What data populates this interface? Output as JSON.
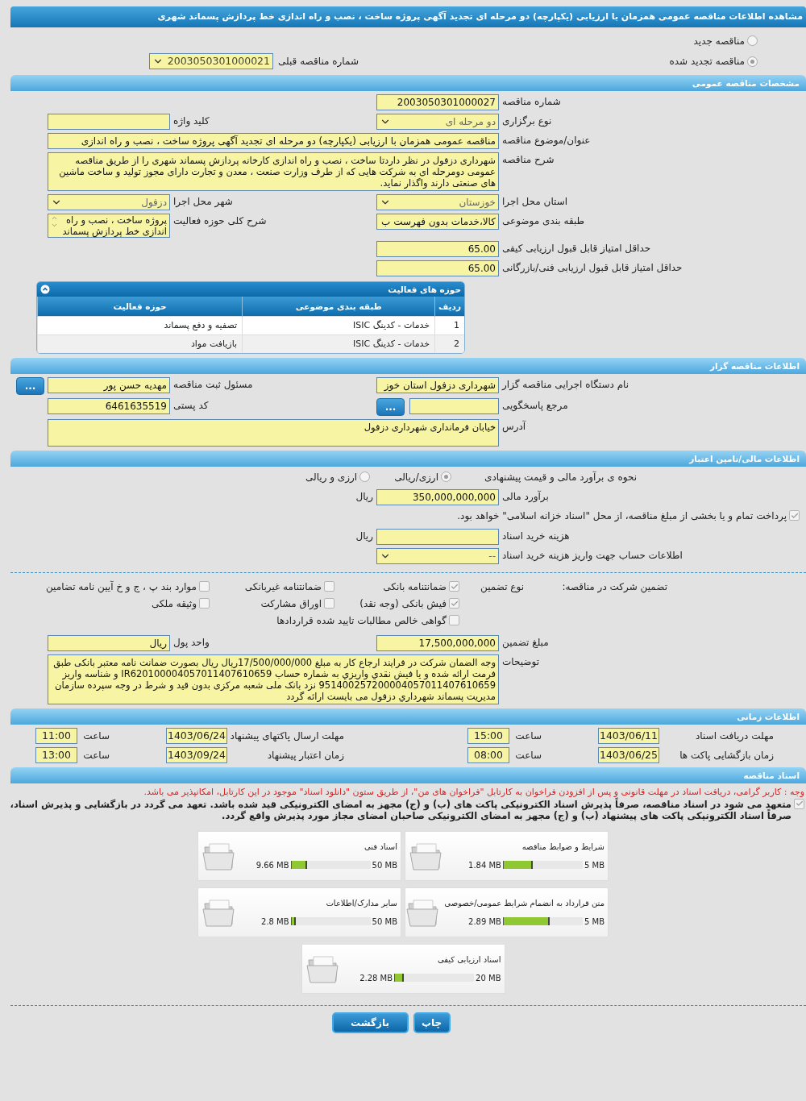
{
  "title": "مشاهده اطلاعات مناقصه عمومی همزمان با ارزیابی (یکپارچه) دو مرحله ای تجدید آگهی پروژه ساخت ، نصب و راه اندازی خط پردازش پسماند شهری",
  "tender_status": [
    {
      "label": "مناقصه جدید",
      "selected": false
    },
    {
      "label": "مناقصه تجدید شده",
      "selected": true
    }
  ],
  "previous_tender": {
    "label": "شماره مناقصه قبلی",
    "value": "2003050301000021"
  },
  "general": {
    "heading": "مشخصات مناقصه عمومی",
    "rows": [
      [
        {
          "label": "شماره مناقصه",
          "value": "2003050301000027",
          "kind": "text"
        }
      ],
      [
        {
          "label": "نوع برگزاری",
          "value": "دو مرحله ای",
          "kind": "select"
        },
        {
          "label": "کلید واژه",
          "kind": "text"
        }
      ],
      [
        {
          "label": "عنوان/موضوع مناقصه",
          "value": "مناقصه عمومی همزمان با ارزیابی (یکپارچه) دو مرحله ای تجدید آگهی پروژه ساخت ، نصب و راه اندازی",
          "kind": "wide"
        }
      ],
      [
        {
          "label": "شرح مناقصه",
          "value": "شهرداری دزفول در نظر داردتا ساخت ، نصب و راه اندازی کارخانه پردازش پسماند شهری را از طریق مناقصه عمومی دومرحله ای به شرکت هایی که از طرف وزارت صنعت ، معدن و تجارت دارای مجوز تولید و ساخت ماشین های صنعتی دارند واگذار نماید.",
          "kind": "textarea"
        }
      ],
      [
        {
          "label": "استان محل اجرا",
          "value": "خوزستان",
          "kind": "select"
        },
        {
          "label": "شهر محل اجرا",
          "value": "دزفول",
          "kind": "select"
        }
      ],
      [
        {
          "label": "طبقه بندی موضوعی",
          "value": "کالا،خدمات بدون فهرست ب",
          "kind": "text"
        },
        {
          "label": "شرح کلی حوزه فعالیت",
          "value": "پروژه ساخت ، نصب و راه اندازی خط پردازش پسماند",
          "kind": "scroll"
        }
      ],
      [
        {
          "label": "حداقل امتیاز قابل قبول ارزیابی کیفی",
          "value": "65.00",
          "kind": "text"
        }
      ],
      [
        {
          "label": "حداقل امتیاز قابل قبول ارزیابی فنی/بازرگانی",
          "value": "65.00",
          "kind": "text"
        }
      ]
    ]
  },
  "activity": {
    "title": "حوزه های فعالیت",
    "columns": [
      "ردیف",
      "طبقه بندی موضوعی",
      "حوزه فعالیت"
    ],
    "rows": [
      [
        "1",
        "خدمات - کدینگ ISIC",
        "تصفیه و دفع پسماند"
      ],
      [
        "2",
        "خدمات - کدینگ ISIC",
        "بازیافت مواد"
      ]
    ]
  },
  "organizer": {
    "heading": "اطلاعات مناقصه گزار",
    "rows": [
      [
        {
          "label": "نام دستگاه اجرایی مناقصه گزار",
          "value": "شهرداری دزفول استان خوز",
          "kind": "text"
        },
        {
          "label": "مسئول ثبت مناقصه",
          "value": "مهدیه حسن پور",
          "kind": "text",
          "button": "..."
        }
      ],
      [
        {
          "label": "مرجع پاسخگویی",
          "kind": "text",
          "button": "..."
        },
        {
          "label": "کد پستی",
          "value": "6461635519",
          "kind": "text"
        }
      ],
      [
        {
          "label": "آدرس",
          "value": "خیابان فرمانداری شهرداری دزفول",
          "kind": "textarea"
        }
      ]
    ]
  },
  "finance": {
    "heading": "اطلاعات مالی/تامین اعتبار",
    "method": {
      "label": "نحوه ی برآورد مالی و قیمت پیشنهادی",
      "options": [
        {
          "label": "ارزی/ریالی",
          "selected": true
        },
        {
          "label": "ارزی و ریالی",
          "selected": false
        }
      ]
    },
    "rows": [
      [
        {
          "label": "برآورد مالی",
          "value": "350,000,000,000",
          "kind": "text",
          "unit": "ریال"
        }
      ]
    ],
    "treasury": {
      "label": "پرداخت تمام و یا بخشی از مبلغ مناقصه، از محل \"اسناد خزانه اسلامی\" خواهد بود.",
      "checked": true
    },
    "rows_after": [
      [
        {
          "label": "هزینه خرید اسناد",
          "kind": "text",
          "unit": "ریال"
        }
      ],
      [
        {
          "label": "اطلاعات حساب جهت واریز هزینه خرید اسناد",
          "value": "--",
          "kind": "select"
        }
      ]
    ]
  },
  "guarantee": {
    "title": "تضمین شرکت در مناقصه:",
    "type_label": "نوع تضمین",
    "options": [
      {
        "label": "ضمانتنامه بانکی",
        "checked": true
      },
      {
        "label": "ضمانتنامه غیربانکی",
        "checked": false
      },
      {
        "label": "موارد بند پ ، ج و خ آیین نامه تضامین",
        "checked": false
      },
      {
        "label": "فیش بانکی (وجه نقد)",
        "checked": true
      },
      {
        "label": "اوراق مشارکت",
        "checked": false
      },
      {
        "label": "وثیقه ملکی",
        "checked": false
      },
      {
        "label": "گواهی خالص مطالبات تایید شده قراردادها",
        "checked": false
      }
    ],
    "rows": [
      [
        {
          "label": "مبلغ تضمین",
          "value": "17,500,000,000",
          "kind": "text"
        },
        {
          "label": "واحد پول",
          "value": "ریال",
          "kind": "text"
        }
      ],
      [
        {
          "label": "توضیحات",
          "value": "وجه الضمان شرکت در فرایند ارجاع کار به  مبلغ  17/500/000/000ریال ریال بصورت ضمانت نامه معتبر بانکی طبق فرمت ارائه شده و یا  فیش نقدي واريزي  به شماره حساب  IR620100004057011407610659 و شناسه واریز 951400257200004057011407610659 نزد بانک ملی شعبه مرکزی  بدون قید و شرط در وجه سپرده سازمان مدیریت پسماند شهرداري دزفول می بایست ارائه گردد",
          "kind": "textarea"
        }
      ]
    ]
  },
  "timing": {
    "heading": "اطلاعات زمانی",
    "items": [
      {
        "label": "مهلت دریافت اسناد",
        "date": "1403/06/11",
        "time_label": "ساعت",
        "time": "15:00"
      },
      {
        "label": "مهلت ارسال پاکتهای پیشنهاد",
        "date": "1403/06/24",
        "time_label": "ساعت",
        "time": "11:00"
      },
      {
        "label": "زمان بازگشایی پاکت ها",
        "date": "1403/06/25",
        "time_label": "ساعت",
        "time": "08:00"
      },
      {
        "label": "زمان اعتبار پیشنهاد",
        "date": "1403/09/24",
        "time_label": "ساعت",
        "time": "13:00"
      }
    ]
  },
  "documents": {
    "heading": "اسناد مناقصه",
    "notice": "وجه : کاربر گرامی، دریافت اسناد در مهلت قانونی و پس از افزودن فراخوان به کارتابل \"فراخوان های من\"، از طریق ستون \"دانلود اسناد\" موجود در این کارتابل، امکانپذیر می باشد.",
    "commitment": {
      "text": "متعهد می شود در اسناد مناقصه، صرفاً پذیرش اسناد الکترونیکی پاکت های (ب) و (ج) مجهز به امضای الکترونیکی قید شده باشد. تعهد می گردد در بازگشایی و پذیرش اسناد، صرفاً اسناد الکترونیکی پاکت های پیشنهاد (ب) و (ج) مجهز به امضای الکترونیکی صاحبان امضای مجاز مورد پذیرش واقع گردد.",
      "checked": true
    },
    "files": [
      {
        "name": "شرایط و ضوابط مناقصه",
        "size": "1.84 MB",
        "max": "5 MB",
        "level": 0.368
      },
      {
        "name": "اسناد فنی",
        "size": "9.66 MB",
        "max": "50 MB",
        "level": 0.193
      },
      {
        "name": "متن قرارداد به انضمام شرایط عمومی/خصوصی",
        "size": "2.89 MB",
        "max": "5 MB",
        "level": 0.578
      },
      {
        "name": "سایر مدارک/اطلاعات",
        "size": "2.8 MB",
        "max": "50 MB",
        "level": 0.056
      },
      {
        "name": "اسناد ارزیابی کیفی",
        "size": "2.28 MB",
        "max": "20 MB",
        "level": 0.114
      }
    ]
  },
  "buttons": [
    "چاپ",
    "بازگشت"
  ]
}
